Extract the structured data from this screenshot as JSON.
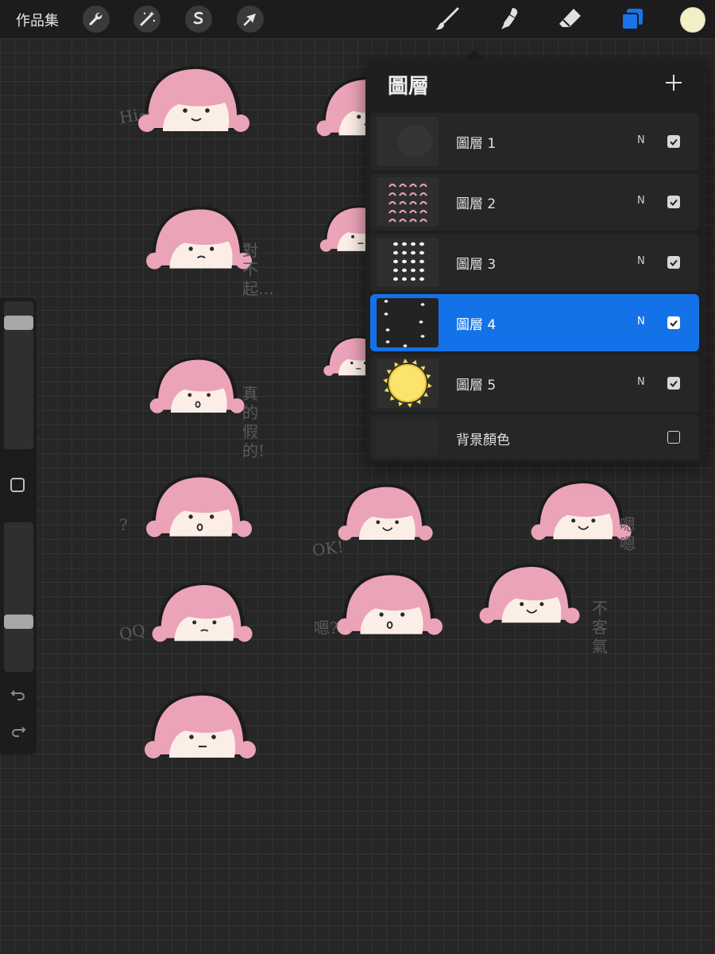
{
  "toolbar": {
    "gallery_label": "作品集",
    "left_tools": [
      "wrench-icon",
      "magic-wand-icon",
      "selection-icon",
      "transform-arrow-icon"
    ],
    "right_tools": [
      "brush-icon",
      "smudge-icon",
      "eraser-icon",
      "layers-icon"
    ],
    "active_color": "#f0efc6",
    "layers_active_color": "#1a73e8"
  },
  "sidebar": {
    "brush_size_level": 0.11,
    "opacity_level": 0.68,
    "modify_icon": "square-icon",
    "undo_icon": "undo-icon",
    "redo_icon": "redo-icon"
  },
  "layers_panel": {
    "title": "圖層",
    "add_icon": "plus-icon",
    "accent": "#1372e8",
    "layers": [
      {
        "name": "圖層 1",
        "blend": "N",
        "visible": true,
        "active": false
      },
      {
        "name": "圖層 2",
        "blend": "N",
        "visible": true,
        "active": false
      },
      {
        "name": "圖層 3",
        "blend": "N",
        "visible": true,
        "active": false
      },
      {
        "name": "圖層 4",
        "blend": "N",
        "visible": true,
        "active": true
      },
      {
        "name": "圖層 5",
        "blend": "N",
        "visible": true,
        "active": false
      }
    ],
    "background": {
      "name": "背景顏色",
      "visible": false
    }
  },
  "canvas": {
    "scribbles": [
      "Hi~",
      "對不起…",
      "真的假的!",
      "?",
      "OK!",
      "嗯嗯",
      "QQ",
      "嗯?",
      "不客氣"
    ]
  }
}
